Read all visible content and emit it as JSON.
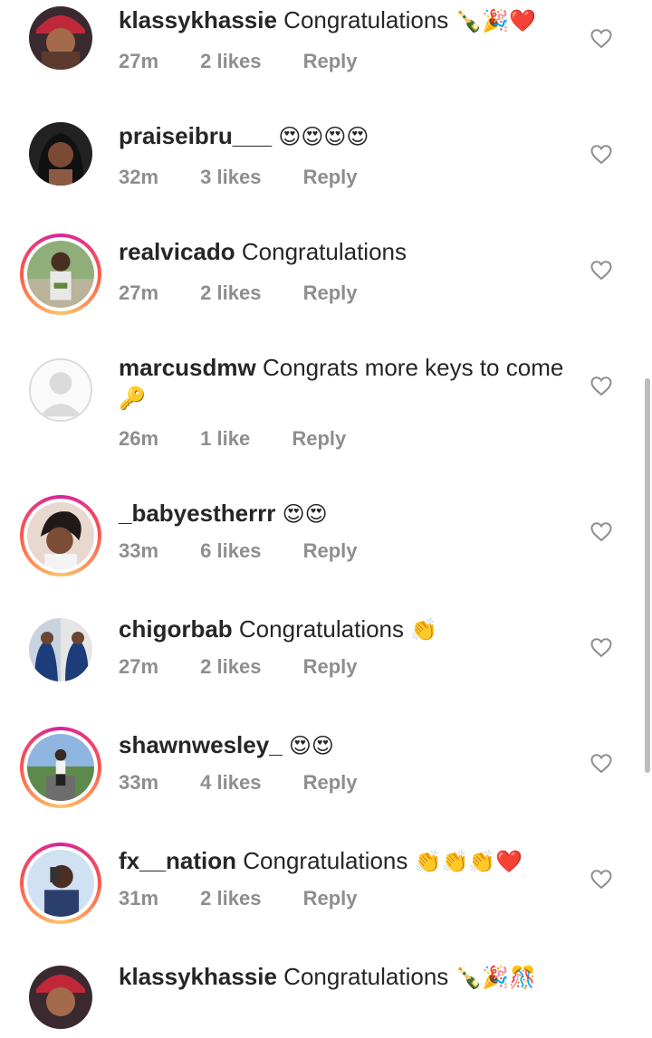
{
  "comments": [
    {
      "username": "klassykhassie",
      "text": "Congratulations",
      "emoji": "🍾🎉❤️",
      "time": "27m",
      "likes": "2 likes",
      "reply": "Reply",
      "story": false,
      "avatar": "girl-red-cap"
    },
    {
      "username": "praiseibru___",
      "text": "",
      "emoji": "😍😍😍😍",
      "time": "32m",
      "likes": "3 likes",
      "reply": "Reply",
      "story": false,
      "avatar": "girl-dark"
    },
    {
      "username": "realvicado",
      "text": "Congratulations",
      "emoji": "",
      "time": "27m",
      "likes": "2 likes",
      "reply": "Reply",
      "story": true,
      "avatar": "man-outdoors"
    },
    {
      "username": "marcusdmw",
      "text": "Congrats more keys to come",
      "emoji": "🔑",
      "time": "26m",
      "likes": "1 like",
      "reply": "Reply",
      "story": false,
      "avatar": "default"
    },
    {
      "username": "_babyestherrr",
      "text": "",
      "emoji": "😍😍",
      "time": "33m",
      "likes": "6 likes",
      "reply": "Reply",
      "story": true,
      "avatar": "girl-portrait"
    },
    {
      "username": "chigorbab",
      "text": "Congratulations",
      "emoji": "👏",
      "time": "27m",
      "likes": "2 likes",
      "reply": "Reply",
      "story": false,
      "avatar": "collage"
    },
    {
      "username": "shawnwesley_",
      "text": "",
      "emoji": "😍😍",
      "time": "33m",
      "likes": "4 likes",
      "reply": "Reply",
      "story": true,
      "avatar": "man-road"
    },
    {
      "username": "fx__nation",
      "text": "Congratulations",
      "emoji": "👏👏👏❤️",
      "time": "31m",
      "likes": "2 likes",
      "reply": "Reply",
      "story": true,
      "avatar": "man-selfie"
    },
    {
      "username": "klassykhassie",
      "text": "Congratulations",
      "emoji": "🍾🎉🎊",
      "time": "",
      "likes": "",
      "reply": "",
      "story": false,
      "avatar": "girl-red-cap"
    }
  ],
  "icons": {
    "like": "heart-outline-icon"
  },
  "colors": {
    "meta": "#8e8e8e",
    "story_ring": [
      "#d6249f",
      "#fd5949",
      "#fdc468"
    ]
  }
}
